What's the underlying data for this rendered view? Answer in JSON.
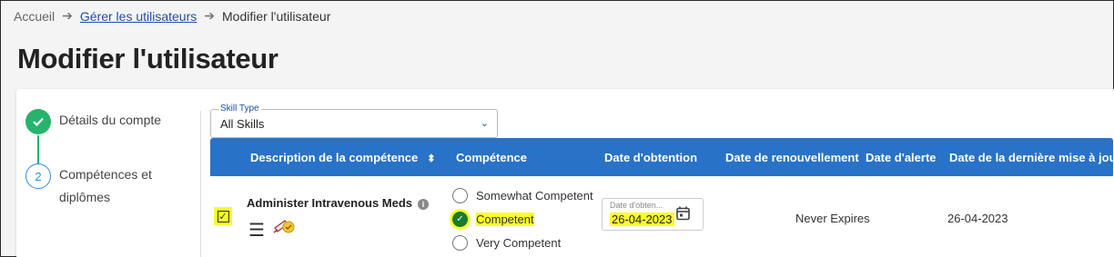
{
  "breadcrumb": {
    "home": "Accueil",
    "manage_users": "Gérer les utilisateurs",
    "current": "Modifier l'utilisateur"
  },
  "page_title": "Modifier l'utilisateur",
  "stepper": {
    "step1_label": "Détails du compte",
    "step2_number": "2",
    "step2_label": "Compétences et diplômes"
  },
  "skill_type": {
    "label": "Skill Type",
    "value": "All Skills"
  },
  "table": {
    "headers": {
      "description": "Description de la compétence",
      "competence": "Compétence",
      "date_obtained": "Date d'obtention",
      "renewal_date": "Date de renouvellement",
      "alert_date": "Date d'alerte",
      "last_update": "Date de la dernière mise à jour"
    },
    "rows": [
      {
        "skill": "Administer Intravenous Meds",
        "options": [
          "Somewhat Competent",
          "Competent",
          "Very Competent"
        ],
        "selected": "Competent",
        "date_label": "Date d'obten...",
        "date_obtained": "26-04-2023",
        "renewal": "Never Expires",
        "last_update": "26-04-2023"
      }
    ]
  },
  "colors": {
    "primary": "#2872c8",
    "success": "#27b36b",
    "highlight": "#fbff2a",
    "selected_radio": "#1a7a2e"
  }
}
